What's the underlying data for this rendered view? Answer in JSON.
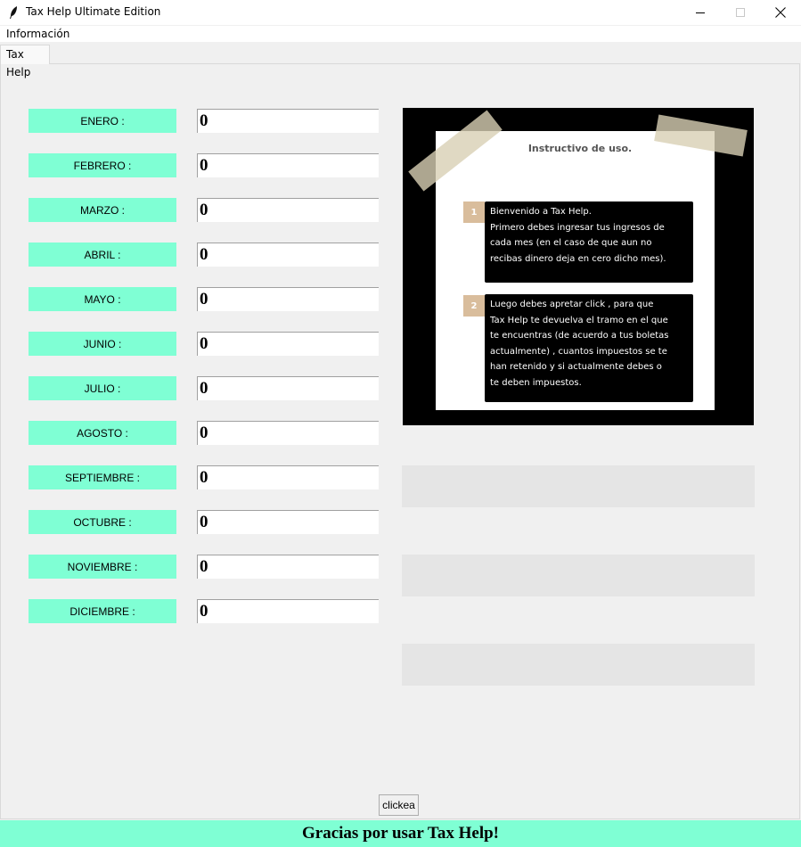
{
  "window": {
    "title": "Tax Help Ultimate Edition",
    "icon": "feather-icon",
    "controls": [
      "minimize-icon",
      "maximize-icon",
      "close-icon"
    ]
  },
  "menu": {
    "items": [
      "Información"
    ]
  },
  "tabs": [
    {
      "label": "Tax Help",
      "selected": true
    }
  ],
  "months": [
    {
      "label": "ENERO :",
      "value": "0"
    },
    {
      "label": "FEBRERO :",
      "value": "0"
    },
    {
      "label": "MARZO :",
      "value": "0"
    },
    {
      "label": "ABRIL :",
      "value": "0"
    },
    {
      "label": "MAYO :",
      "value": "0"
    },
    {
      "label": "JUNIO :",
      "value": "0"
    },
    {
      "label": "JULIO :",
      "value": "0"
    },
    {
      "label": "AGOSTO :",
      "value": "0"
    },
    {
      "label": "SEPTIEMBRE :",
      "value": "0"
    },
    {
      "label": "OCTUBRE :",
      "value": "0"
    },
    {
      "label": "NOVIEMBRE :",
      "value": "0"
    },
    {
      "label": "DICIEMBRE :",
      "value": "0"
    }
  ],
  "instructions": {
    "title": "Instructivo de uso.",
    "steps": [
      {
        "number": "1",
        "lines": [
          "Bienvenido a Tax Help.",
          "Primero debes ingresar tus ingresos de",
          "cada mes (en el caso de que aun no",
          "recibas dinero deja en cero dicho mes)."
        ]
      },
      {
        "number": "2",
        "lines": [
          "Luego debes apretar click , para que",
          "Tax Help te devuelva el tramo en el que",
          "te encuentras (de acuerdo a tus boletas",
          "actualmente) , cuantos impuestos se te",
          "han retenido y si actualmente debes o",
          "te deben impuestos."
        ]
      }
    ]
  },
  "results": [
    "",
    "",
    ""
  ],
  "action": {
    "label": "clickea"
  },
  "footer": {
    "text": "Gracias por usar Tax Help!"
  },
  "colors": {
    "accent": "#7fffd4",
    "window_bg": "#f0f0f0",
    "result_bg": "#e5e5e5",
    "card_bg": "#000000",
    "step_number_bg": "#d9bd9c"
  }
}
